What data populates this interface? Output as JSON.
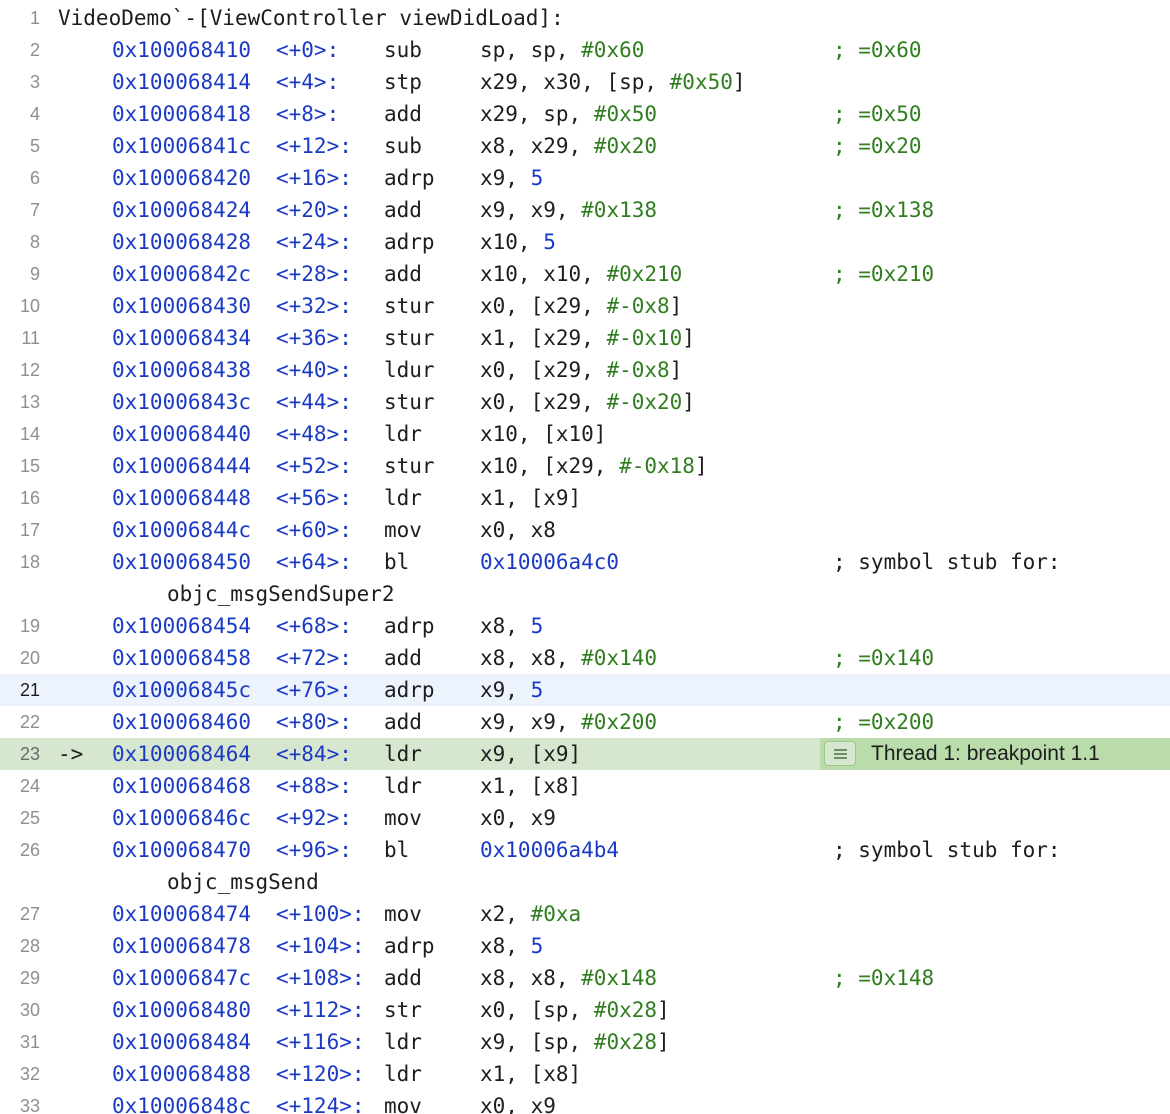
{
  "header": {
    "line": "1",
    "title": "VideoDemo`-[ViewController viewDidLoad]:"
  },
  "current_line": "21",
  "pc_line": "23",
  "pc_arrow": "->",
  "breakpoint_label": "Thread 1: breakpoint 1.1",
  "icons": {
    "breakpoint_badge": "lines-icon"
  },
  "colors": {
    "address": "#1b3ac4",
    "literal": "#2f7d1e",
    "current_line_bg": "#edf3fd",
    "pc_line_bg": "#d7e7cf"
  },
  "instructions": [
    {
      "line": "2",
      "addr": "0x100068410",
      "off": "<+0>:",
      "op": "sub",
      "args": [
        [
          "t",
          "sp, sp, "
        ],
        [
          "n",
          "#0x60"
        ]
      ],
      "comment": "; =0x60"
    },
    {
      "line": "3",
      "addr": "0x100068414",
      "off": "<+4>:",
      "op": "stp",
      "args": [
        [
          "t",
          "x29, x30, [sp, "
        ],
        [
          "n",
          "#0x50"
        ],
        [
          "t",
          "]"
        ]
      ]
    },
    {
      "line": "4",
      "addr": "0x100068418",
      "off": "<+8>:",
      "op": "add",
      "args": [
        [
          "t",
          "x29, sp, "
        ],
        [
          "n",
          "#0x50"
        ]
      ],
      "comment": "; =0x50"
    },
    {
      "line": "5",
      "addr": "0x10006841c",
      "off": "<+12>:",
      "op": "sub",
      "args": [
        [
          "t",
          "x8, x29, "
        ],
        [
          "n",
          "#0x20"
        ]
      ],
      "comment": "; =0x20"
    },
    {
      "line": "6",
      "addr": "0x100068420",
      "off": "<+16>:",
      "op": "adrp",
      "args": [
        [
          "t",
          "x9, "
        ],
        [
          "b",
          "5"
        ]
      ]
    },
    {
      "line": "7",
      "addr": "0x100068424",
      "off": "<+20>:",
      "op": "add",
      "args": [
        [
          "t",
          "x9, x9, "
        ],
        [
          "n",
          "#0x138"
        ]
      ],
      "comment": "; =0x138"
    },
    {
      "line": "8",
      "addr": "0x100068428",
      "off": "<+24>:",
      "op": "adrp",
      "args": [
        [
          "t",
          "x10, "
        ],
        [
          "b",
          "5"
        ]
      ]
    },
    {
      "line": "9",
      "addr": "0x10006842c",
      "off": "<+28>:",
      "op": "add",
      "args": [
        [
          "t",
          "x10, x10, "
        ],
        [
          "n",
          "#0x210"
        ]
      ],
      "comment": "; =0x210"
    },
    {
      "line": "10",
      "addr": "0x100068430",
      "off": "<+32>:",
      "op": "stur",
      "args": [
        [
          "t",
          "x0, [x29, "
        ],
        [
          "n",
          "#-0x8"
        ],
        [
          "t",
          "]"
        ]
      ]
    },
    {
      "line": "11",
      "addr": "0x100068434",
      "off": "<+36>:",
      "op": "stur",
      "args": [
        [
          "t",
          "x1, [x29, "
        ],
        [
          "n",
          "#-0x10"
        ],
        [
          "t",
          "]"
        ]
      ]
    },
    {
      "line": "12",
      "addr": "0x100068438",
      "off": "<+40>:",
      "op": "ldur",
      "args": [
        [
          "t",
          "x0, [x29, "
        ],
        [
          "n",
          "#-0x8"
        ],
        [
          "t",
          "]"
        ]
      ]
    },
    {
      "line": "13",
      "addr": "0x10006843c",
      "off": "<+44>:",
      "op": "stur",
      "args": [
        [
          "t",
          "x0, [x29, "
        ],
        [
          "n",
          "#-0x20"
        ],
        [
          "t",
          "]"
        ]
      ]
    },
    {
      "line": "14",
      "addr": "0x100068440",
      "off": "<+48>:",
      "op": "ldr",
      "args": [
        [
          "t",
          "x10, [x10]"
        ]
      ]
    },
    {
      "line": "15",
      "addr": "0x100068444",
      "off": "<+52>:",
      "op": "stur",
      "args": [
        [
          "t",
          "x10, [x29, "
        ],
        [
          "n",
          "#-0x18"
        ],
        [
          "t",
          "]"
        ]
      ]
    },
    {
      "line": "16",
      "addr": "0x100068448",
      "off": "<+56>:",
      "op": "ldr",
      "args": [
        [
          "t",
          "x1, [x9]"
        ]
      ]
    },
    {
      "line": "17",
      "addr": "0x10006844c",
      "off": "<+60>:",
      "op": "mov",
      "args": [
        [
          "t",
          "x0, x8"
        ]
      ]
    },
    {
      "line": "18",
      "addr": "0x100068450",
      "off": "<+64>:",
      "op": "bl",
      "args": [
        [
          "b",
          "0x10006a4c0"
        ]
      ],
      "symbol": "; symbol stub for:",
      "wrap": "objc_msgSendSuper2"
    },
    {
      "line": "19",
      "addr": "0x100068454",
      "off": "<+68>:",
      "op": "adrp",
      "args": [
        [
          "t",
          "x8, "
        ],
        [
          "b",
          "5"
        ]
      ]
    },
    {
      "line": "20",
      "addr": "0x100068458",
      "off": "<+72>:",
      "op": "add",
      "args": [
        [
          "t",
          "x8, x8, "
        ],
        [
          "n",
          "#0x140"
        ]
      ],
      "comment": "; =0x140"
    },
    {
      "line": "21",
      "addr": "0x10006845c",
      "off": "<+76>:",
      "op": "adrp",
      "args": [
        [
          "t",
          "x9, "
        ],
        [
          "b",
          "5"
        ]
      ]
    },
    {
      "line": "22",
      "addr": "0x100068460",
      "off": "<+80>:",
      "op": "add",
      "args": [
        [
          "t",
          "x9, x9, "
        ],
        [
          "n",
          "#0x200"
        ]
      ],
      "comment": "; =0x200"
    },
    {
      "line": "23",
      "addr": "0x100068464",
      "off": "<+84>:",
      "op": "ldr",
      "args": [
        [
          "t",
          "x9, [x9]"
        ]
      ]
    },
    {
      "line": "24",
      "addr": "0x100068468",
      "off": "<+88>:",
      "op": "ldr",
      "args": [
        [
          "t",
          "x1, [x8]"
        ]
      ]
    },
    {
      "line": "25",
      "addr": "0x10006846c",
      "off": "<+92>:",
      "op": "mov",
      "args": [
        [
          "t",
          "x0, x9"
        ]
      ]
    },
    {
      "line": "26",
      "addr": "0x100068470",
      "off": "<+96>:",
      "op": "bl",
      "args": [
        [
          "b",
          "0x10006a4b4"
        ]
      ],
      "symbol": "; symbol stub for:",
      "wrap": "objc_msgSend"
    },
    {
      "line": "27",
      "addr": "0x100068474",
      "off": "<+100>:",
      "op": "mov",
      "args": [
        [
          "t",
          "x2, "
        ],
        [
          "n",
          "#0xa"
        ]
      ]
    },
    {
      "line": "28",
      "addr": "0x100068478",
      "off": "<+104>:",
      "op": "adrp",
      "args": [
        [
          "t",
          "x8, "
        ],
        [
          "b",
          "5"
        ]
      ]
    },
    {
      "line": "29",
      "addr": "0x10006847c",
      "off": "<+108>:",
      "op": "add",
      "args": [
        [
          "t",
          "x8, x8, "
        ],
        [
          "n",
          "#0x148"
        ]
      ],
      "comment": "; =0x148"
    },
    {
      "line": "30",
      "addr": "0x100068480",
      "off": "<+112>:",
      "op": "str",
      "args": [
        [
          "t",
          "x0, [sp, "
        ],
        [
          "n",
          "#0x28"
        ],
        [
          "t",
          "]"
        ]
      ]
    },
    {
      "line": "31",
      "addr": "0x100068484",
      "off": "<+116>:",
      "op": "ldr",
      "args": [
        [
          "t",
          "x9, [sp, "
        ],
        [
          "n",
          "#0x28"
        ],
        [
          "t",
          "]"
        ]
      ]
    },
    {
      "line": "32",
      "addr": "0x100068488",
      "off": "<+120>:",
      "op": "ldr",
      "args": [
        [
          "t",
          "x1, [x8]"
        ]
      ]
    },
    {
      "line": "33",
      "addr": "0x10006848c",
      "off": "<+124>:",
      "op": "mov",
      "args": [
        [
          "t",
          "x0, x9"
        ]
      ]
    }
  ]
}
